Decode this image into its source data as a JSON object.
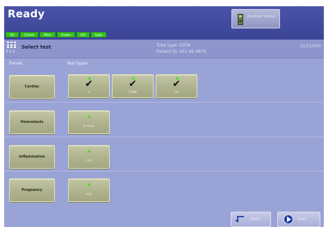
{
  "header": {
    "title": "Ready",
    "status_button_label": "Analyzer Status",
    "chips": [
      "Tst",
      "Chem",
      "Mon",
      "Exam",
      "Dll",
      "Sale"
    ]
  },
  "select_bar": {
    "title": "Select test",
    "icon_sublabel": "F 1 2",
    "tube_type": "Tube type: EDTA",
    "patient_id": "Patient ID: 431-45-9876",
    "date": "12/11/200"
  },
  "columns": {
    "panels": "Panels",
    "test_types": "Test types"
  },
  "panels": [
    {
      "label": "Cardiac",
      "tests": [
        {
          "label": "A",
          "selected": true
        },
        {
          "label": "CKMB",
          "selected": true
        },
        {
          "label": "BN",
          "selected": true
        }
      ]
    },
    {
      "label": "Hemostasis",
      "tests": [
        {
          "label": "D-dimer",
          "selected": false
        }
      ]
    },
    {
      "label": "Inflammation",
      "tests": [
        {
          "label": "CRP",
          "selected": false
        }
      ]
    },
    {
      "label": "Pregnancy",
      "tests": [
        {
          "label": "hCG",
          "selected": false
        }
      ]
    }
  ],
  "footer": {
    "back_label": "Back",
    "start_label": "Start"
  },
  "colors": {
    "screen_bg": "#9aa3d6",
    "titlebar": "#3b4497",
    "chip_green": "#35c01f",
    "button": "#aeb28d"
  }
}
